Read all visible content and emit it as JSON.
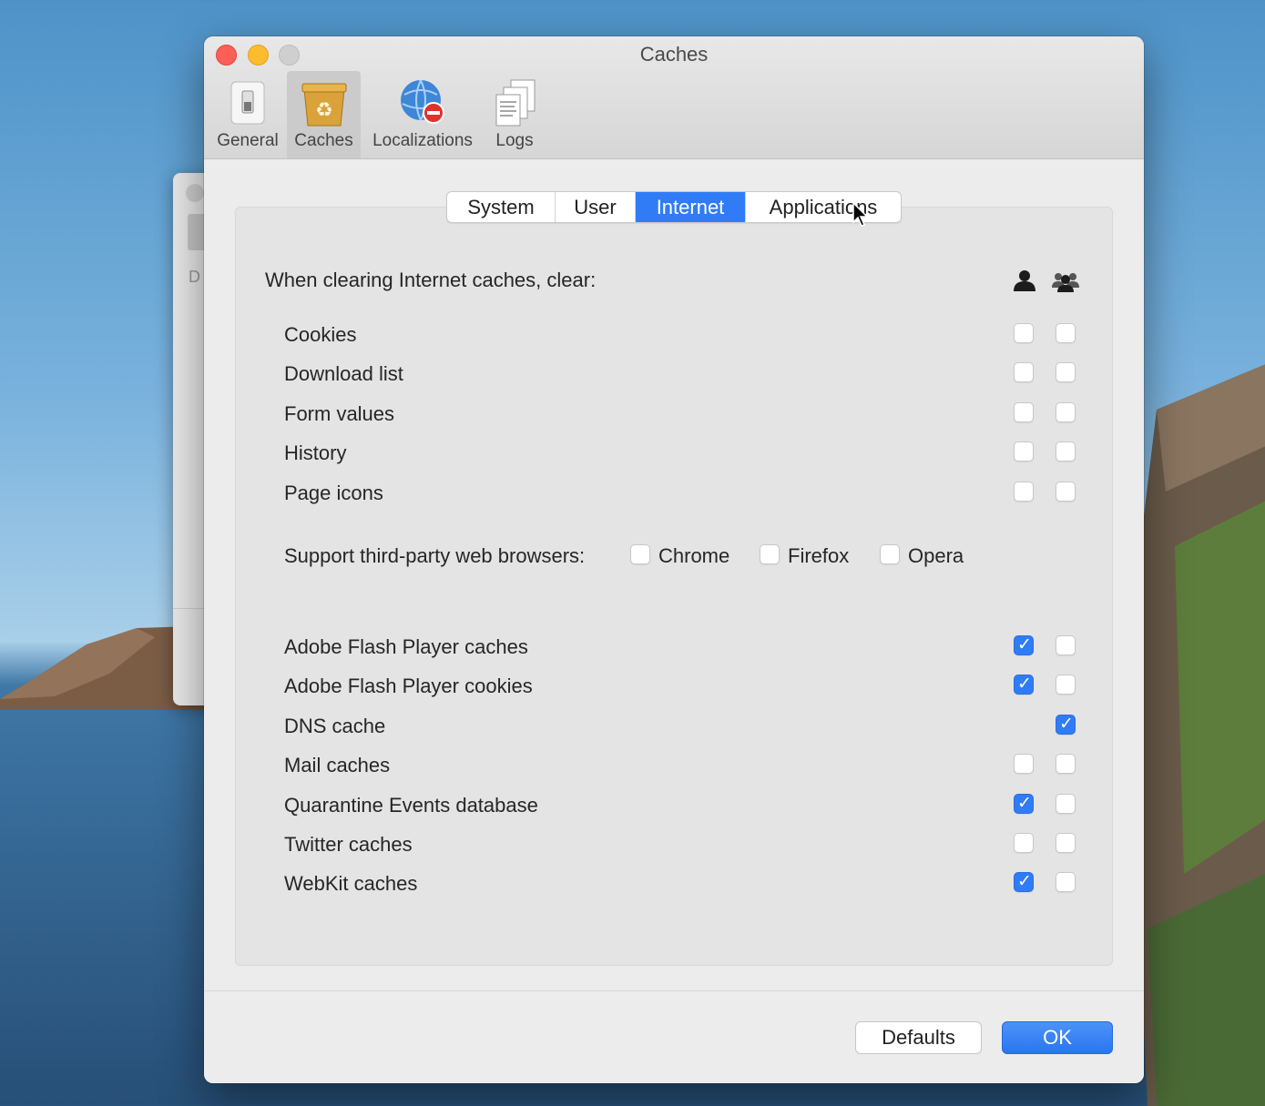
{
  "window": {
    "title": "Caches"
  },
  "toolbar": {
    "items": [
      {
        "label": "General",
        "icon": "general-switch-icon"
      },
      {
        "label": "Caches",
        "icon": "recycle-box-icon",
        "selected": true
      },
      {
        "label": "Localizations",
        "icon": "globe-no-entry-icon"
      },
      {
        "label": "Logs",
        "icon": "documents-icon"
      }
    ]
  },
  "background_window": {
    "label": "D"
  },
  "tabs": [
    {
      "label": "System"
    },
    {
      "label": "User"
    },
    {
      "label": "Internet",
      "selected": true
    },
    {
      "label": "Applications"
    }
  ],
  "section": {
    "heading": "When clearing Internet caches, clear:",
    "column_icons": [
      "single-user-icon",
      "all-users-icon"
    ]
  },
  "rows_top": [
    {
      "label": "Cookies",
      "user": false,
      "all": false
    },
    {
      "label": "Download list",
      "user": false,
      "all": false
    },
    {
      "label": "Form values",
      "user": false,
      "all": false
    },
    {
      "label": "History",
      "user": false,
      "all": false
    },
    {
      "label": "Page icons",
      "user": false,
      "all": false
    }
  ],
  "browsers": {
    "label": "Support third-party web browsers:",
    "options": [
      {
        "label": "Chrome",
        "checked": false
      },
      {
        "label": "Firefox",
        "checked": false
      },
      {
        "label": "Opera",
        "checked": false
      }
    ]
  },
  "rows_bottom": [
    {
      "label": "Adobe Flash Player caches",
      "user": true,
      "all": false
    },
    {
      "label": "Adobe Flash Player cookies",
      "user": true,
      "all": false
    },
    {
      "label": "DNS cache",
      "user": null,
      "all": true
    },
    {
      "label": "Mail caches",
      "user": false,
      "all": false
    },
    {
      "label": "Quarantine Events database",
      "user": true,
      "all": false
    },
    {
      "label": "Twitter caches",
      "user": false,
      "all": false
    },
    {
      "label": "WebKit caches",
      "user": true,
      "all": false
    }
  ],
  "buttons": {
    "defaults": "Defaults",
    "ok": "OK"
  },
  "colors": {
    "accent": "#2f7cf6"
  }
}
